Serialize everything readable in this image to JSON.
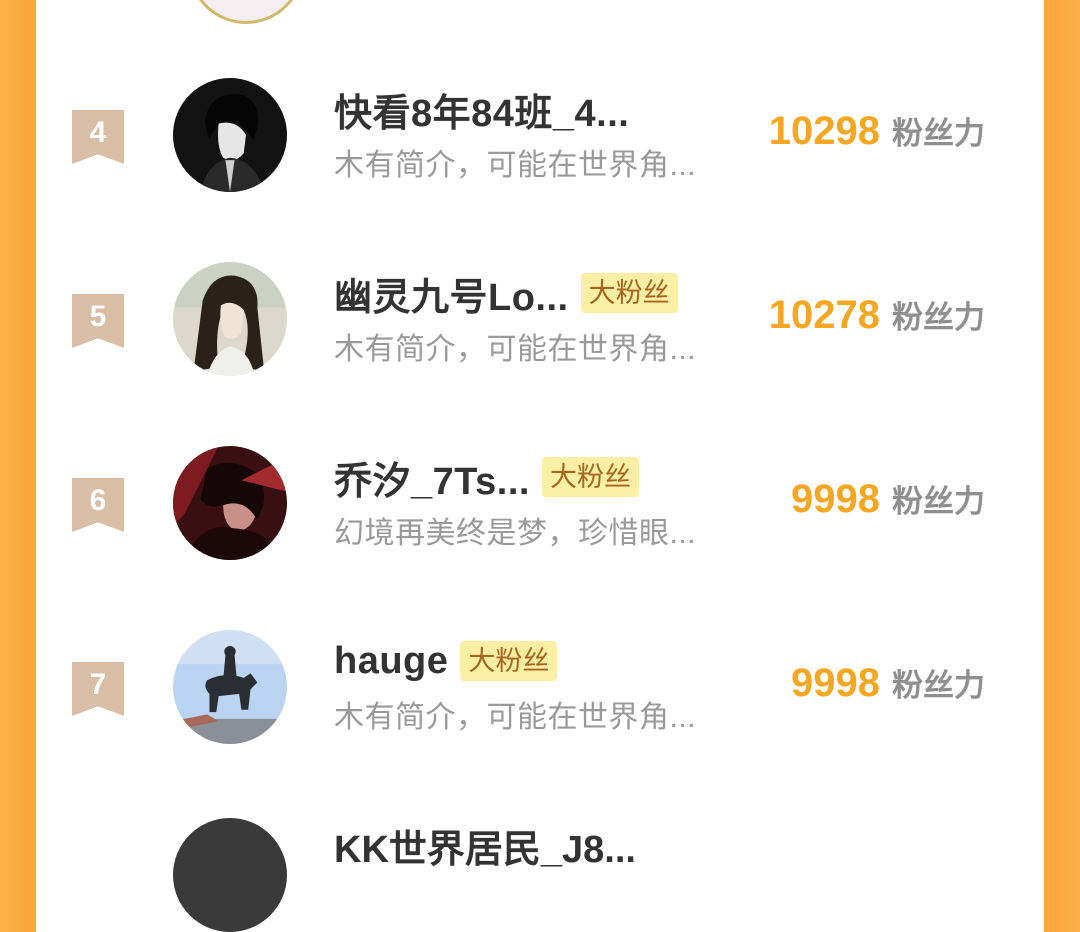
{
  "unit_label": "粉丝力",
  "rows": [
    {
      "rank": "4",
      "name": "快看8年84班_4...",
      "badge": "",
      "bio": "木有简介，可能在世界角...",
      "score": "10298",
      "avatar": "dark-haired-man-avatar"
    },
    {
      "rank": "5",
      "name": "幽灵九号Lo...",
      "badge": "大粉丝",
      "bio": "木有简介，可能在世界角...",
      "score": "10278",
      "avatar": "long-haired-man-avatar"
    },
    {
      "rank": "6",
      "name": "乔汐_7Ts...",
      "badge": "大粉丝",
      "bio": "幻境再美终是梦，珍惜眼...",
      "score": "9998",
      "avatar": "red-dark-character-avatar"
    },
    {
      "rank": "7",
      "name": "hauge",
      "badge": "大粉丝",
      "bio": "木有简介，可能在世界角...",
      "score": "9998",
      "avatar": "equestrian-statue-avatar"
    }
  ],
  "next_row": {
    "name": "KK世界居民_J8..."
  },
  "colors": {
    "accent": "#f5a623",
    "badge_bg": "#fbeea5",
    "badge_text": "#a5661d",
    "rank_ribbon": "#d8bea5",
    "frame": "#f9a53a"
  }
}
